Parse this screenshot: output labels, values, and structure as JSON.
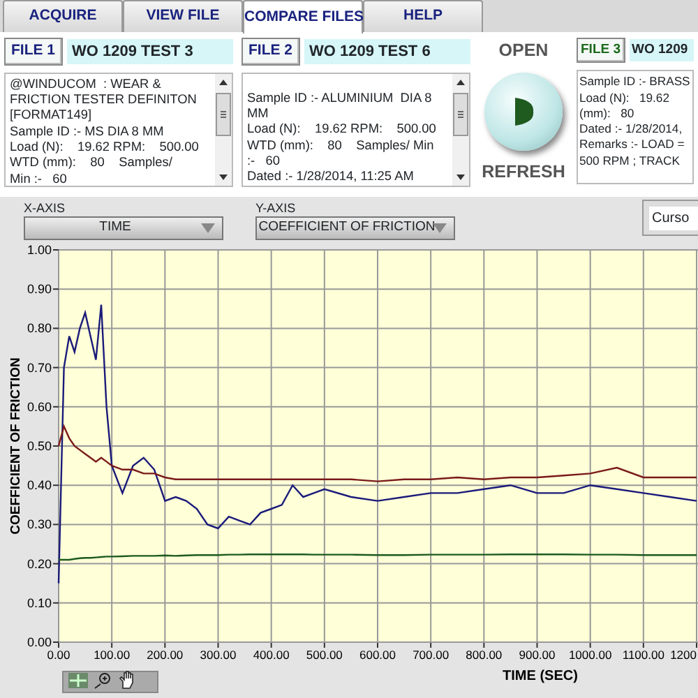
{
  "tabs": [
    {
      "label": "ACQUIRE",
      "selected": false
    },
    {
      "label": "VIEW FILE",
      "selected": false
    },
    {
      "label": "COMPARE FILES",
      "selected": true
    },
    {
      "label": "HELP",
      "selected": false
    }
  ],
  "files": [
    {
      "label": "FILE 1",
      "color": "#1a237e",
      "name": "WO 1209 TEST 3",
      "lines": [
        "@WINDUCOM  : WEAR &",
        "FRICTION TESTER DEFINITON",
        "[FORMAT149]",
        "Sample ID :- MS DIA 8 MM",
        "Load (N):    19.62 RPM:    500.00",
        "WTD (mm):    80    Samples/",
        "Min :-   60"
      ]
    },
    {
      "label": "FILE 2",
      "color": "#1a237e",
      "name": "WO 1209 TEST 6",
      "lines": [
        "Sample ID :- ALUMINIUM  DIA 8",
        "MM",
        "Load (N):    19.62 RPM:    500.00",
        "WTD (mm):    80    Samples/ Min",
        ":-   60",
        "Dated :- 1/28/2014, 11:25 AM"
      ]
    },
    {
      "label": "FILE 3",
      "color": "#1c6b1c",
      "name": "WO 1209",
      "lines": [
        "Sample ID :- BRASS",
        "Load (N):   19.62",
        "(mm):   80",
        "Dated :- 1/28/2014,",
        "Remarks :- LOAD =",
        "500 RPM ; TRACK"
      ]
    }
  ],
  "open_button": {
    "top_label": "OPEN",
    "bottom_label": "REFRESH"
  },
  "x_axis": {
    "label": "X-AXIS",
    "value": "TIME"
  },
  "y_axis": {
    "label": "Y-AXIS",
    "value": "COEFFICIENT OF FRICTION"
  },
  "cursor_button": "Curso",
  "chart_data": {
    "type": "line",
    "grid": true,
    "xlabel": "TIME (SEC)",
    "ylabel": "COEFFICIENT OF FRICTION",
    "xlim": [
      0,
      1210
    ],
    "ylim": [
      0,
      1
    ],
    "xticks": [
      {
        "value": 0,
        "label": "0.00"
      },
      {
        "value": 100,
        "label": "100.00"
      },
      {
        "value": 200,
        "label": "200.00"
      },
      {
        "value": 300,
        "label": "300.00"
      },
      {
        "value": 400,
        "label": "400.00"
      },
      {
        "value": 500,
        "label": "500.00"
      },
      {
        "value": 600,
        "label": "600.00"
      },
      {
        "value": 700,
        "label": "700.00"
      },
      {
        "value": 800,
        "label": "800.00"
      },
      {
        "value": 900,
        "label": "900.00"
      },
      {
        "value": 1000,
        "label": "1000.00"
      },
      {
        "value": 1100,
        "label": "1100.00"
      },
      {
        "value": 1200,
        "label": "1200"
      }
    ],
    "yticks": [
      {
        "value": 0,
        "label": "0.00"
      },
      {
        "value": 0.1,
        "label": "0.10"
      },
      {
        "value": 0.2,
        "label": "0.20"
      },
      {
        "value": 0.3,
        "label": "0.30"
      },
      {
        "value": 0.4,
        "label": "0.40"
      },
      {
        "value": 0.5,
        "label": "0.50"
      },
      {
        "value": 0.6,
        "label": "0.60"
      },
      {
        "value": 0.7,
        "label": "0.70"
      },
      {
        "value": 0.8,
        "label": "0.80"
      },
      {
        "value": 0.9,
        "label": "0.90"
      },
      {
        "value": 1,
        "label": "1.00"
      }
    ],
    "x": [
      0,
      10,
      20,
      30,
      40,
      50,
      60,
      70,
      80,
      90,
      100,
      120,
      140,
      160,
      180,
      200,
      220,
      240,
      260,
      280,
      300,
      320,
      340,
      360,
      380,
      400,
      420,
      440,
      460,
      480,
      500,
      550,
      600,
      650,
      700,
      750,
      800,
      850,
      900,
      950,
      1000,
      1050,
      1100,
      1150,
      1200
    ],
    "series": [
      {
        "color": "#1a1a7a",
        "values": [
          0.15,
          0.7,
          0.78,
          0.74,
          0.8,
          0.84,
          0.78,
          0.72,
          0.86,
          0.6,
          0.45,
          0.38,
          0.45,
          0.47,
          0.44,
          0.36,
          0.37,
          0.36,
          0.34,
          0.3,
          0.29,
          0.32,
          0.31,
          0.3,
          0.33,
          0.34,
          0.35,
          0.4,
          0.37,
          0.38,
          0.39,
          0.37,
          0.36,
          0.37,
          0.38,
          0.38,
          0.39,
          0.4,
          0.38,
          0.38,
          0.4,
          0.39,
          0.38,
          0.37,
          0.36
        ]
      },
      {
        "color": "#7a1a1a",
        "values": [
          0.5,
          0.55,
          0.52,
          0.5,
          0.49,
          0.48,
          0.47,
          0.46,
          0.47,
          0.46,
          0.45,
          0.44,
          0.44,
          0.43,
          0.43,
          0.42,
          0.415,
          0.415,
          0.415,
          0.415,
          0.415,
          0.415,
          0.415,
          0.415,
          0.415,
          0.415,
          0.415,
          0.415,
          0.415,
          0.415,
          0.415,
          0.415,
          0.41,
          0.415,
          0.415,
          0.42,
          0.415,
          0.42,
          0.42,
          0.425,
          0.43,
          0.445,
          0.42,
          0.42,
          0.42
        ]
      },
      {
        "color": "#1c5a1c",
        "values": [
          0.21,
          0.21,
          0.21,
          0.212,
          0.214,
          0.215,
          0.215,
          0.216,
          0.217,
          0.218,
          0.218,
          0.219,
          0.22,
          0.22,
          0.22,
          0.221,
          0.22,
          0.221,
          0.222,
          0.222,
          0.222,
          0.223,
          0.223,
          0.224,
          0.224,
          0.224,
          0.224,
          0.224,
          0.224,
          0.223,
          0.223,
          0.223,
          0.222,
          0.222,
          0.223,
          0.223,
          0.223,
          0.224,
          0.224,
          0.224,
          0.223,
          0.223,
          0.222,
          0.222,
          0.222
        ]
      }
    ]
  }
}
